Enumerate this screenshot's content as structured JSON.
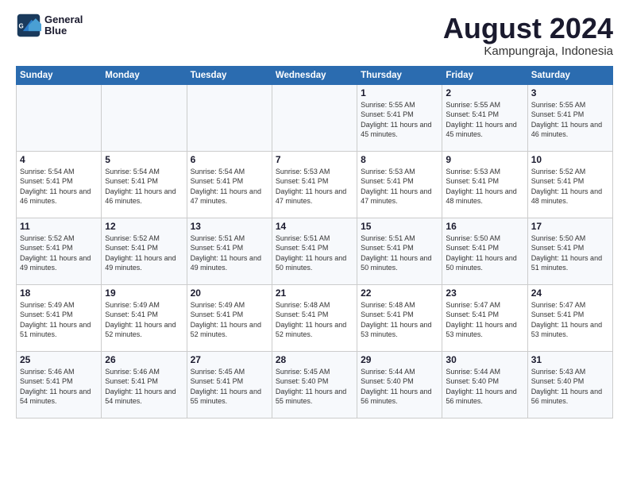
{
  "header": {
    "logo_line1": "General",
    "logo_line2": "Blue",
    "month_title": "August 2024",
    "location": "Kampungraja, Indonesia"
  },
  "weekdays": [
    "Sunday",
    "Monday",
    "Tuesday",
    "Wednesday",
    "Thursday",
    "Friday",
    "Saturday"
  ],
  "weeks": [
    [
      {
        "day": "",
        "sunrise": "",
        "sunset": "",
        "daylight": ""
      },
      {
        "day": "",
        "sunrise": "",
        "sunset": "",
        "daylight": ""
      },
      {
        "day": "",
        "sunrise": "",
        "sunset": "",
        "daylight": ""
      },
      {
        "day": "",
        "sunrise": "",
        "sunset": "",
        "daylight": ""
      },
      {
        "day": "1",
        "sunrise": "Sunrise: 5:55 AM",
        "sunset": "Sunset: 5:41 PM",
        "daylight": "Daylight: 11 hours and 45 minutes."
      },
      {
        "day": "2",
        "sunrise": "Sunrise: 5:55 AM",
        "sunset": "Sunset: 5:41 PM",
        "daylight": "Daylight: 11 hours and 45 minutes."
      },
      {
        "day": "3",
        "sunrise": "Sunrise: 5:55 AM",
        "sunset": "Sunset: 5:41 PM",
        "daylight": "Daylight: 11 hours and 46 minutes."
      }
    ],
    [
      {
        "day": "4",
        "sunrise": "Sunrise: 5:54 AM",
        "sunset": "Sunset: 5:41 PM",
        "daylight": "Daylight: 11 hours and 46 minutes."
      },
      {
        "day": "5",
        "sunrise": "Sunrise: 5:54 AM",
        "sunset": "Sunset: 5:41 PM",
        "daylight": "Daylight: 11 hours and 46 minutes."
      },
      {
        "day": "6",
        "sunrise": "Sunrise: 5:54 AM",
        "sunset": "Sunset: 5:41 PM",
        "daylight": "Daylight: 11 hours and 47 minutes."
      },
      {
        "day": "7",
        "sunrise": "Sunrise: 5:53 AM",
        "sunset": "Sunset: 5:41 PM",
        "daylight": "Daylight: 11 hours and 47 minutes."
      },
      {
        "day": "8",
        "sunrise": "Sunrise: 5:53 AM",
        "sunset": "Sunset: 5:41 PM",
        "daylight": "Daylight: 11 hours and 47 minutes."
      },
      {
        "day": "9",
        "sunrise": "Sunrise: 5:53 AM",
        "sunset": "Sunset: 5:41 PM",
        "daylight": "Daylight: 11 hours and 48 minutes."
      },
      {
        "day": "10",
        "sunrise": "Sunrise: 5:52 AM",
        "sunset": "Sunset: 5:41 PM",
        "daylight": "Daylight: 11 hours and 48 minutes."
      }
    ],
    [
      {
        "day": "11",
        "sunrise": "Sunrise: 5:52 AM",
        "sunset": "Sunset: 5:41 PM",
        "daylight": "Daylight: 11 hours and 49 minutes."
      },
      {
        "day": "12",
        "sunrise": "Sunrise: 5:52 AM",
        "sunset": "Sunset: 5:41 PM",
        "daylight": "Daylight: 11 hours and 49 minutes."
      },
      {
        "day": "13",
        "sunrise": "Sunrise: 5:51 AM",
        "sunset": "Sunset: 5:41 PM",
        "daylight": "Daylight: 11 hours and 49 minutes."
      },
      {
        "day": "14",
        "sunrise": "Sunrise: 5:51 AM",
        "sunset": "Sunset: 5:41 PM",
        "daylight": "Daylight: 11 hours and 50 minutes."
      },
      {
        "day": "15",
        "sunrise": "Sunrise: 5:51 AM",
        "sunset": "Sunset: 5:41 PM",
        "daylight": "Daylight: 11 hours and 50 minutes."
      },
      {
        "day": "16",
        "sunrise": "Sunrise: 5:50 AM",
        "sunset": "Sunset: 5:41 PM",
        "daylight": "Daylight: 11 hours and 50 minutes."
      },
      {
        "day": "17",
        "sunrise": "Sunrise: 5:50 AM",
        "sunset": "Sunset: 5:41 PM",
        "daylight": "Daylight: 11 hours and 51 minutes."
      }
    ],
    [
      {
        "day": "18",
        "sunrise": "Sunrise: 5:49 AM",
        "sunset": "Sunset: 5:41 PM",
        "daylight": "Daylight: 11 hours and 51 minutes."
      },
      {
        "day": "19",
        "sunrise": "Sunrise: 5:49 AM",
        "sunset": "Sunset: 5:41 PM",
        "daylight": "Daylight: 11 hours and 52 minutes."
      },
      {
        "day": "20",
        "sunrise": "Sunrise: 5:49 AM",
        "sunset": "Sunset: 5:41 PM",
        "daylight": "Daylight: 11 hours and 52 minutes."
      },
      {
        "day": "21",
        "sunrise": "Sunrise: 5:48 AM",
        "sunset": "Sunset: 5:41 PM",
        "daylight": "Daylight: 11 hours and 52 minutes."
      },
      {
        "day": "22",
        "sunrise": "Sunrise: 5:48 AM",
        "sunset": "Sunset: 5:41 PM",
        "daylight": "Daylight: 11 hours and 53 minutes."
      },
      {
        "day": "23",
        "sunrise": "Sunrise: 5:47 AM",
        "sunset": "Sunset: 5:41 PM",
        "daylight": "Daylight: 11 hours and 53 minutes."
      },
      {
        "day": "24",
        "sunrise": "Sunrise: 5:47 AM",
        "sunset": "Sunset: 5:41 PM",
        "daylight": "Daylight: 11 hours and 53 minutes."
      }
    ],
    [
      {
        "day": "25",
        "sunrise": "Sunrise: 5:46 AM",
        "sunset": "Sunset: 5:41 PM",
        "daylight": "Daylight: 11 hours and 54 minutes."
      },
      {
        "day": "26",
        "sunrise": "Sunrise: 5:46 AM",
        "sunset": "Sunset: 5:41 PM",
        "daylight": "Daylight: 11 hours and 54 minutes."
      },
      {
        "day": "27",
        "sunrise": "Sunrise: 5:45 AM",
        "sunset": "Sunset: 5:41 PM",
        "daylight": "Daylight: 11 hours and 55 minutes."
      },
      {
        "day": "28",
        "sunrise": "Sunrise: 5:45 AM",
        "sunset": "Sunset: 5:40 PM",
        "daylight": "Daylight: 11 hours and 55 minutes."
      },
      {
        "day": "29",
        "sunrise": "Sunrise: 5:44 AM",
        "sunset": "Sunset: 5:40 PM",
        "daylight": "Daylight: 11 hours and 56 minutes."
      },
      {
        "day": "30",
        "sunrise": "Sunrise: 5:44 AM",
        "sunset": "Sunset: 5:40 PM",
        "daylight": "Daylight: 11 hours and 56 minutes."
      },
      {
        "day": "31",
        "sunrise": "Sunrise: 5:43 AM",
        "sunset": "Sunset: 5:40 PM",
        "daylight": "Daylight: 11 hours and 56 minutes."
      }
    ]
  ]
}
